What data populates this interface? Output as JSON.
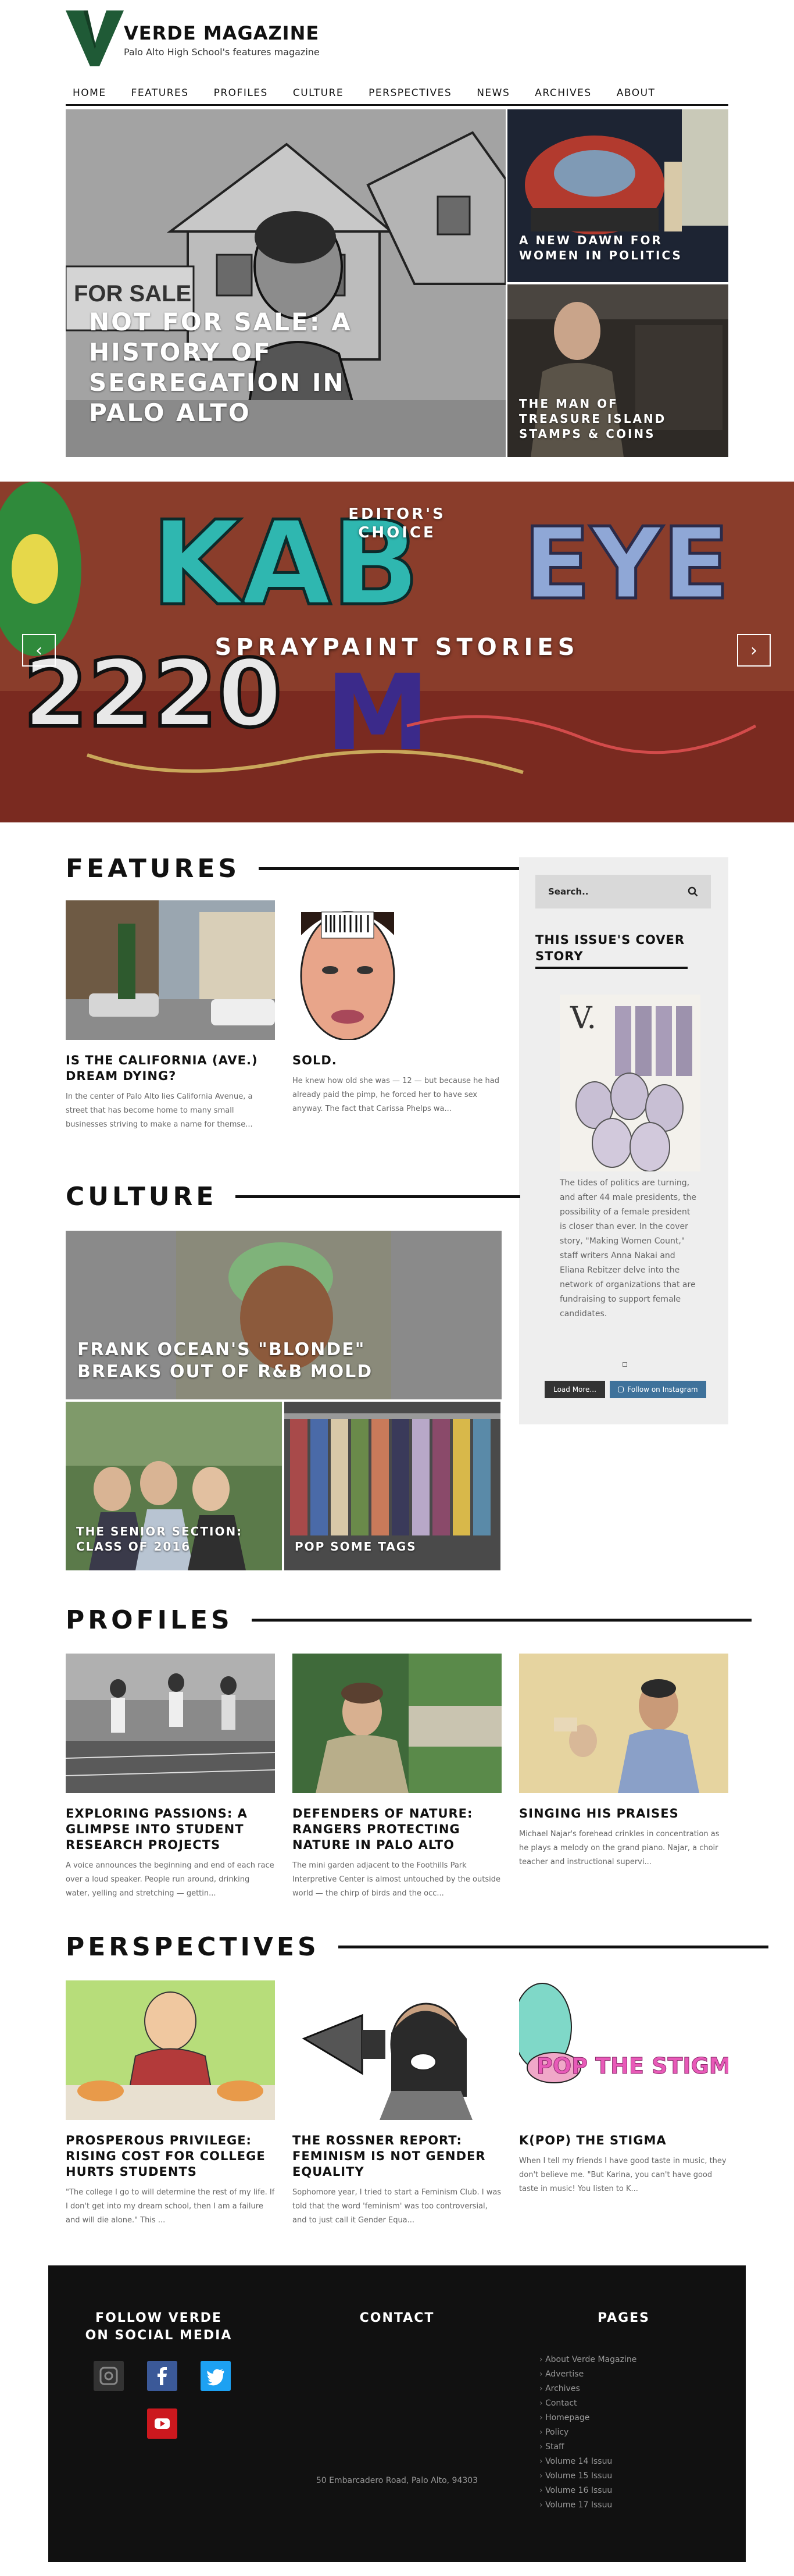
{
  "site": {
    "title": "VERDE MAGAZINE",
    "subtitle": "Palo Alto High School's features magazine",
    "logo_letter": "V"
  },
  "nav": [
    "HOME",
    "FEATURES",
    "PROFILES",
    "CULTURE",
    "PERSPECTIVES",
    "NEWS",
    "ARCHIVES",
    "ABOUT"
  ],
  "hero": {
    "main_title": "NOT FOR SALE: A HISTORY OF SEGREGATION IN PALO ALTO",
    "main_sign": "FOR SALE",
    "side1_title": "A NEW DAWN FOR WOMEN IN POLITICS",
    "side2_title": "THE MAN OF TREASURE ISLAND STAMPS & COINS"
  },
  "banner": {
    "kicker": "EDITOR'S CHOICE",
    "title": "SPRAYPAINT STORIES",
    "prev": "‹",
    "next": "›"
  },
  "features": {
    "heading": "FEATURES",
    "cards": [
      {
        "title": "IS THE CALIFORNIA (AVE.) DREAM DYING?",
        "excerpt": "In the center of Palo Alto lies California Avenue, a street that has become home to many small businesses striving to make a name for themse..."
      },
      {
        "title": "SOLD.",
        "excerpt": "He knew how old she was — 12 — but because he had already paid the pimp, he forced her to have sex anyway. The fact that Carissa Phelps wa..."
      }
    ]
  },
  "sidebar": {
    "search_placeholder": "Search..",
    "cover_heading": "THIS ISSUE'S COVER STORY",
    "cover_letter": "V.",
    "cover_text": "The tides of politics are turning, and after 44 male presidents, the possibility of a female president is closer than ever. In the cover story, \"Making Women Count,\" staff writers Anna Nakai and Eliana Rebitzer delve into the network of organizations that are fundraising to support female candidates.",
    "load_more": "Load More...",
    "follow_instagram": "Follow on Instagram"
  },
  "culture": {
    "heading": "CULTURE",
    "main_title": "FRANK OCEAN'S \"BLONDE\" BREAKS OUT OF R&B MOLD",
    "small1_title": "THE SENIOR SECTION: CLASS OF 2016",
    "small2_title": "POP SOME TAGS"
  },
  "profiles": {
    "heading": "PROFILES",
    "cards": [
      {
        "title": "EXPLORING PASSIONS: A GLIMPSE INTO STUDENT RESEARCH PROJECTS",
        "excerpt": "A voice announces the beginning and end of each race over a loud speaker. People run around, drinking water, yelling and stretching — gettin..."
      },
      {
        "title": "DEFENDERS OF NATURE: RANGERS PROTECTING NATURE IN PALO ALTO",
        "excerpt": "The mini garden adjacent to the Foothills Park Interpretive Center is almost untouched by the outside world — the chirp of birds and the occ..."
      },
      {
        "title": "SINGING HIS PRAISES",
        "excerpt": "Michael Najar's forehead crinkles in concentration as he plays a melody on the grand piano. Najar, a choir teacher and instructional supervi..."
      }
    ]
  },
  "perspectives": {
    "heading": "PERSPECTIVES",
    "cards": [
      {
        "title": "PROSPEROUS PRIVILEGE: RISING COST FOR COLLEGE HURTS STUDENTS",
        "excerpt": "\"The college I go to will determine the rest of my life. If I don't get into my dream school, then I am a failure and will die alone.\" This ..."
      },
      {
        "title": "THE ROSSNER REPORT: FEMINISM IS NOT GENDER EQUALITY",
        "excerpt": "Sophomore year, I tried to start a Feminism Club. I was told that the word 'feminism' was too controversial, and to just call it Gender Equa..."
      },
      {
        "title": "K(POP) THE STIGMA",
        "excerpt": "When I tell my friends I have good taste in music, they don't believe me. \"But Karina, you can't have good taste in music! You listen to K...",
        "art_text": "POP THE STIGMA"
      }
    ]
  },
  "footer": {
    "follow_heading": "FOLLOW VERDE ON SOCIAL MEDIA",
    "contact_heading": "CONTACT",
    "pages_heading": "PAGES",
    "address": "50 Embarcadero Road, Palo Alto, 94303",
    "pages": [
      "About Verde Magazine",
      "Advertise",
      "Archives",
      "Contact",
      "Homepage",
      "Policy",
      "Staff",
      "Volume 14 Issuu",
      "Volume 15 Issuu",
      "Volume 16 Issuu",
      "Volume 17 Issuu"
    ]
  },
  "colors": {
    "brand_green": "#1f5a36",
    "footer_bg": "#111111",
    "facebook": "#3b5998",
    "twitter": "#1da1f2",
    "youtube": "#cc181e",
    "instagram_btn": "#3f729b"
  }
}
